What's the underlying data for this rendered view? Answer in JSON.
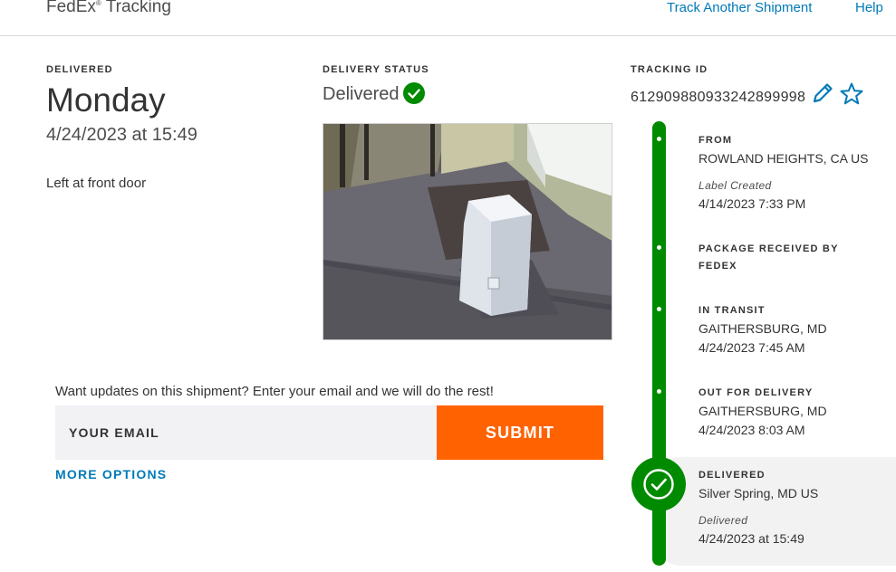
{
  "header": {
    "brand": "FedEx",
    "brand_sup": "®",
    "brand_suffix": "Tracking",
    "track_another": "Track Another Shipment",
    "help": "Help"
  },
  "delivery": {
    "label": "DELIVERED",
    "day": "Monday",
    "datetime": "4/24/2023 at 15:49",
    "note": "Left at front door"
  },
  "status": {
    "label": "DELIVERY STATUS",
    "value": "Delivered"
  },
  "tracking": {
    "label": "TRACKING ID",
    "id": "612909880933242899998"
  },
  "timeline": [
    {
      "title": "FROM",
      "location": "ROWLAND HEIGHTS, CA US",
      "sub": "Label Created",
      "time": "4/14/2023 7:33 PM"
    },
    {
      "title": "PACKAGE RECEIVED BY FEDEX",
      "location": "",
      "sub": "",
      "time": ""
    },
    {
      "title": "IN TRANSIT",
      "location": "GAITHERSBURG, MD",
      "sub": "",
      "time": "4/24/2023 7:45 AM"
    },
    {
      "title": "OUT FOR DELIVERY",
      "location": "GAITHERSBURG, MD",
      "sub": "",
      "time": "4/24/2023 8:03 AM"
    },
    {
      "title": "DELIVERED",
      "location": "Silver Spring, MD US",
      "sub": "Delivered",
      "time": "4/24/2023 at 15:49"
    }
  ],
  "email": {
    "prompt": "Want updates on this shipment? Enter your email and we will do the rest!",
    "placeholder": "YOUR EMAIL",
    "submit": "SUBMIT",
    "more_options": "MORE OPTIONS"
  },
  "colors": {
    "brand_orange": "#ff6200",
    "link_blue": "#007ab7",
    "status_green": "#008a00"
  },
  "icons": {
    "status": "check-circle-icon",
    "edit": "pencil-icon",
    "favorite": "star-icon",
    "delivered": "check-circle-icon"
  }
}
